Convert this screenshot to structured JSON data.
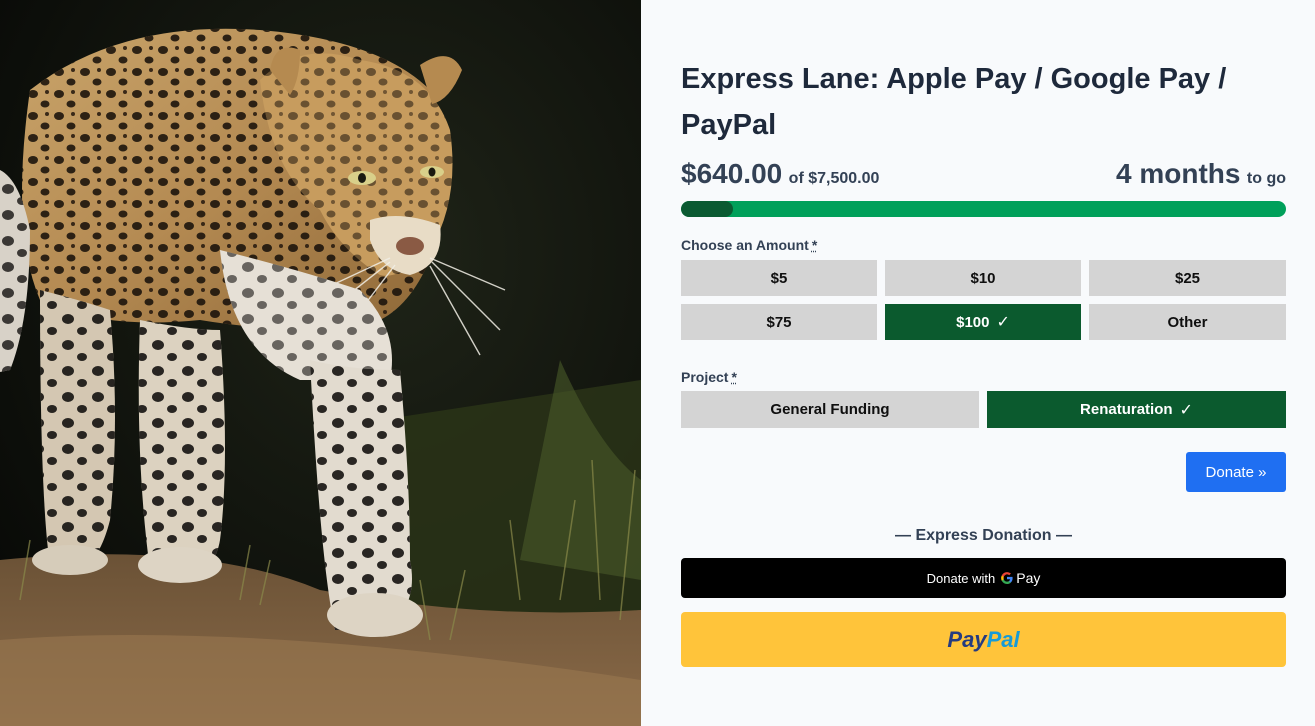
{
  "hero": {
    "alt": "leopard-photo"
  },
  "campaign": {
    "title": "Express Lane: Apple Pay / Google Pay / PayPal",
    "raised": "$640.00",
    "goal_text": "of $7,500.00",
    "time_value": "4 months",
    "time_suffix": "to go",
    "progress_fraction": 0.0853
  },
  "amount": {
    "label": "Choose an Amount",
    "required_mark": "*",
    "options": [
      "$5",
      "$10",
      "$25",
      "$75",
      "$100",
      "Other"
    ],
    "selected": "$100"
  },
  "project": {
    "label": "Project",
    "required_mark": "*",
    "options": [
      "General Funding",
      "Renaturation"
    ],
    "selected": "Renaturation"
  },
  "donate_button": "Donate »",
  "express": {
    "label": "— Express Donation —",
    "gpay_prefix": "Donate with",
    "gpay_suffix": "Pay",
    "paypal_part1": "Pay",
    "paypal_part2": "Pal"
  },
  "colors": {
    "progress_track": "#00a05a",
    "progress_fill": "#0b5a32",
    "selected_option": "#0b5a2e",
    "donate_button": "#1f6ff2",
    "paypal": "#ffc43a"
  }
}
